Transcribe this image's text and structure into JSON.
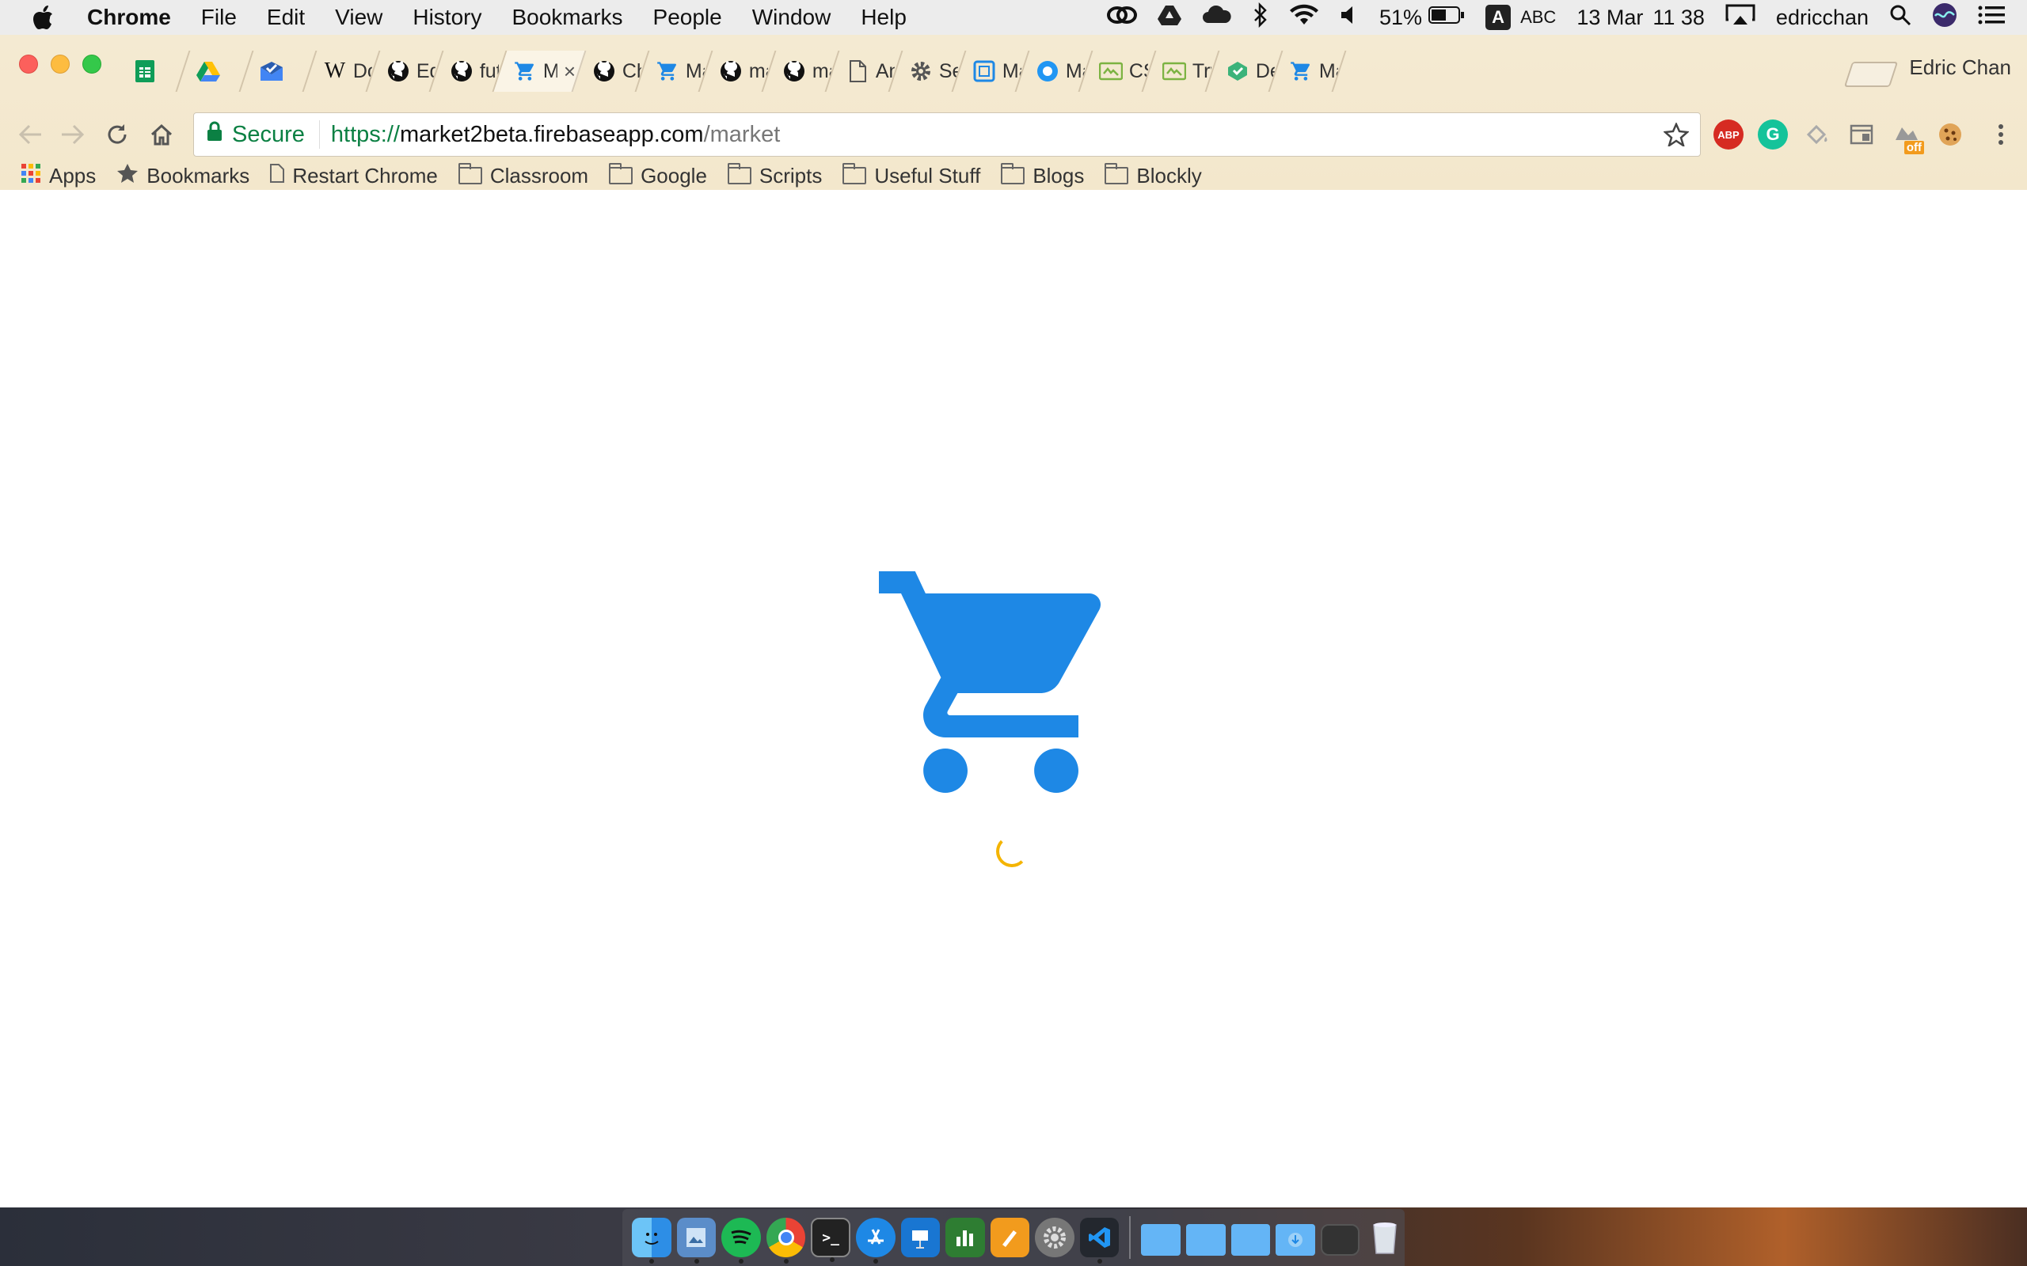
{
  "menubar": {
    "app_name": "Chrome",
    "items": [
      "File",
      "Edit",
      "View",
      "History",
      "Bookmarks",
      "People",
      "Window",
      "Help"
    ],
    "battery": "51%",
    "input_source": "A",
    "input_label": "ABC",
    "date": "13 Mar",
    "time": "11 38",
    "user": "edricchan"
  },
  "tabs": [
    {
      "icon": "sheets-icon",
      "label": ""
    },
    {
      "icon": "drive-icon",
      "label": ""
    },
    {
      "icon": "inbox-icon",
      "label": ""
    },
    {
      "icon": "wikipedia-icon",
      "label": "Dor"
    },
    {
      "icon": "github-icon",
      "label": "Edit"
    },
    {
      "icon": "github-icon",
      "label": "futu"
    },
    {
      "icon": "cart-icon",
      "label": "M",
      "active": true
    },
    {
      "icon": "github-icon",
      "label": "Cha"
    },
    {
      "icon": "cart-icon",
      "label": "Mar"
    },
    {
      "icon": "github-icon",
      "label": "mat"
    },
    {
      "icon": "github-icon",
      "label": "mat"
    },
    {
      "icon": "document-icon",
      "label": "Ang"
    },
    {
      "icon": "gear-icon",
      "label": "Sett"
    },
    {
      "icon": "material-icon",
      "label": "Mat"
    },
    {
      "icon": "material-circle-icon",
      "label": "Mat"
    },
    {
      "icon": "codepen-icon",
      "label": "CSS"
    },
    {
      "icon": "codepen-icon",
      "label": "Tryi"
    },
    {
      "icon": "deploy-icon",
      "label": "Dep"
    },
    {
      "icon": "cart-icon",
      "label": "Mar"
    }
  ],
  "profile_name": "Edric Chan",
  "omnibox": {
    "secure_label": "Secure",
    "url_scheme": "https://",
    "url_host": "market2beta.firebaseapp.com",
    "url_path": "/market"
  },
  "bookmarks": [
    {
      "icon": "apps-grid-icon",
      "label": "Apps"
    },
    {
      "icon": "star-icon",
      "label": "Bookmarks"
    },
    {
      "icon": "page-icon",
      "label": "Restart Chrome"
    },
    {
      "icon": "folder-icon",
      "label": "Classroom"
    },
    {
      "icon": "folder-icon",
      "label": "Google"
    },
    {
      "icon": "folder-icon",
      "label": "Scripts"
    },
    {
      "icon": "folder-icon",
      "label": "Useful Stuff"
    },
    {
      "icon": "folder-icon",
      "label": "Blogs"
    },
    {
      "icon": "folder-icon",
      "label": "Blockly"
    }
  ],
  "extensions": [
    {
      "name": "adblock-icon",
      "label": "ABP"
    },
    {
      "name": "grammarly-icon",
      "label": "G"
    },
    {
      "name": "paint-bucket-icon",
      "label": ""
    },
    {
      "name": "window-icon",
      "label": ""
    },
    {
      "name": "off-badge-icon",
      "label": "off"
    },
    {
      "name": "cookie-icon",
      "label": ""
    }
  ],
  "colors": {
    "cart": "#1e88e5",
    "spinner": "#f4b400",
    "secure": "#0b8043"
  },
  "dock_apps": [
    "finder-icon",
    "preview-icon",
    "spotify-icon",
    "chrome-icon",
    "terminal-icon",
    "app-store-icon",
    "keynote-icon",
    "numbers-icon",
    "pages-icon",
    "system-preferences-icon",
    "vscode-icon",
    "folder-icon",
    "folder-icon",
    "folder-icon",
    "downloads-icon",
    "screen-icon",
    "trash-icon"
  ]
}
